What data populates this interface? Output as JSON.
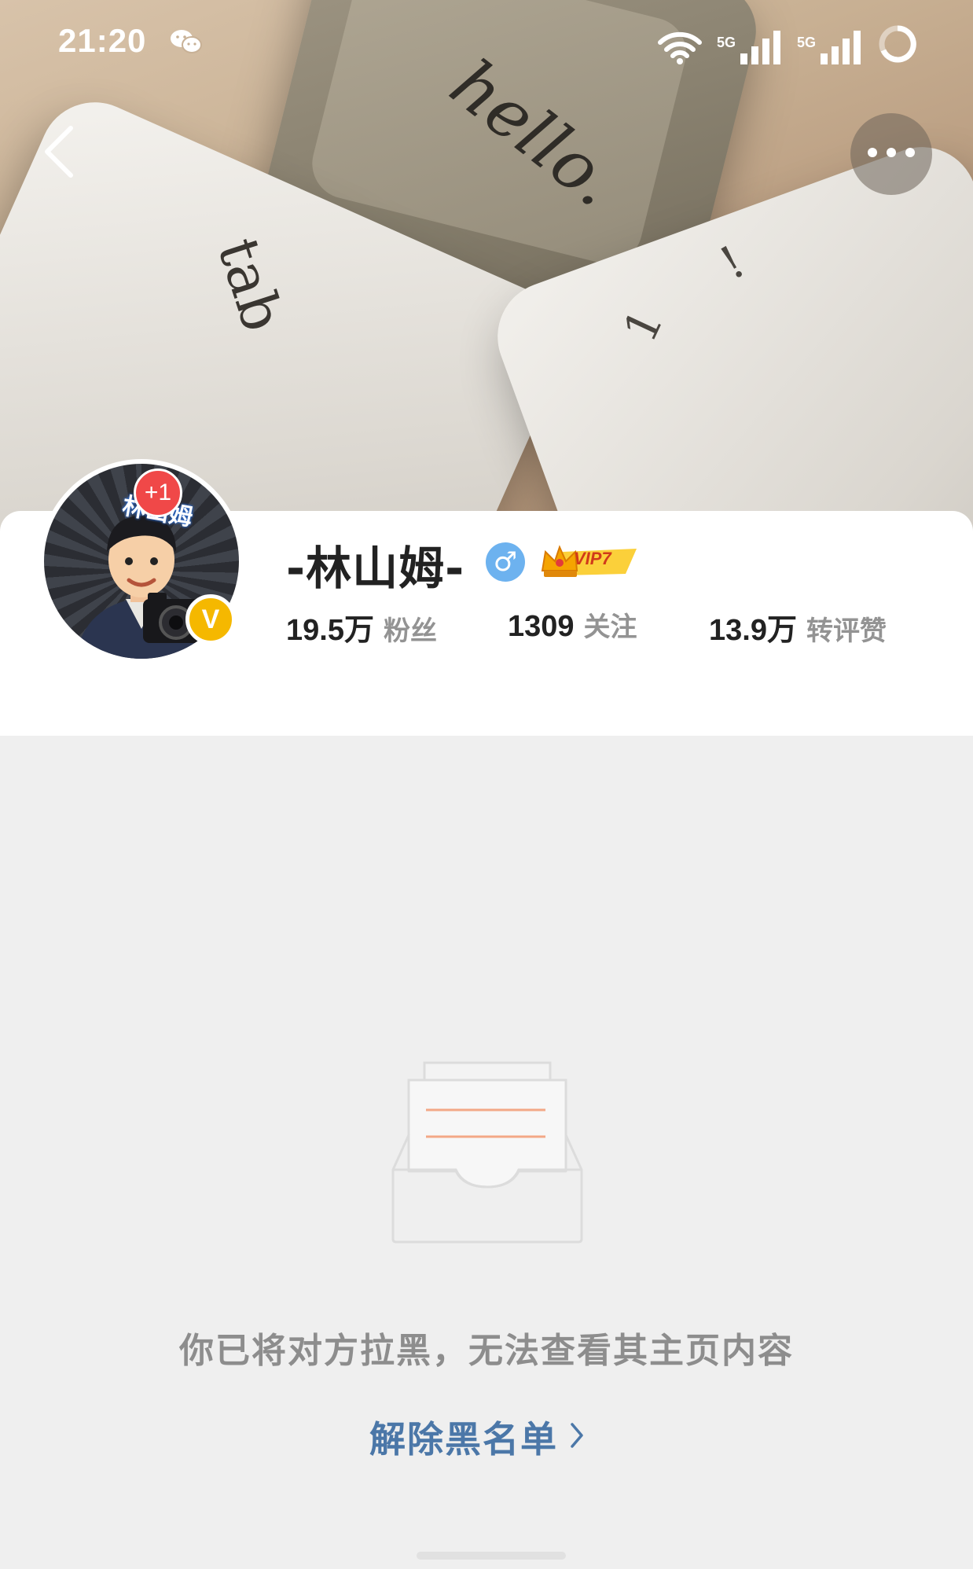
{
  "status_bar": {
    "time": "21:20",
    "notification_icon": "wechat-icon",
    "network_1": "5G",
    "network_2": "5G",
    "icons": [
      "wifi-icon",
      "signal-icon",
      "signal-icon",
      "battery-ring-icon"
    ]
  },
  "nav": {
    "back_icon": "chevron-left-icon",
    "more_icon": "more-dots-icon"
  },
  "cover": {
    "keycap_1": "hello.",
    "keycap_2": "tab",
    "keycap_3": "1",
    "keycap_4": "!"
  },
  "profile": {
    "avatar_stamp": "林山姆",
    "notification_badge": "+1",
    "verified_badge": "V",
    "username": "-林山姆-",
    "gender_icon": "male-icon",
    "gender_symbol": "♂",
    "vip_label": "VIP7",
    "stats": [
      {
        "value": "19.5万",
        "label": "粉丝"
      },
      {
        "value": "1309",
        "label": "关注"
      },
      {
        "value": "13.9万",
        "label": "转评赞"
      }
    ]
  },
  "blocked": {
    "illustration": "inbox-tray-icon",
    "message": "你已将对方拉黑，无法查看其主页内容",
    "unblock_label": "解除黑名单",
    "unblock_icon": "chevron-right-icon"
  },
  "colors": {
    "accent_link": "#4b77a8",
    "verified": "#f5b800",
    "gender": "#6db2ef",
    "badge_red": "#f04848",
    "illustration_line": "#f3a887"
  }
}
